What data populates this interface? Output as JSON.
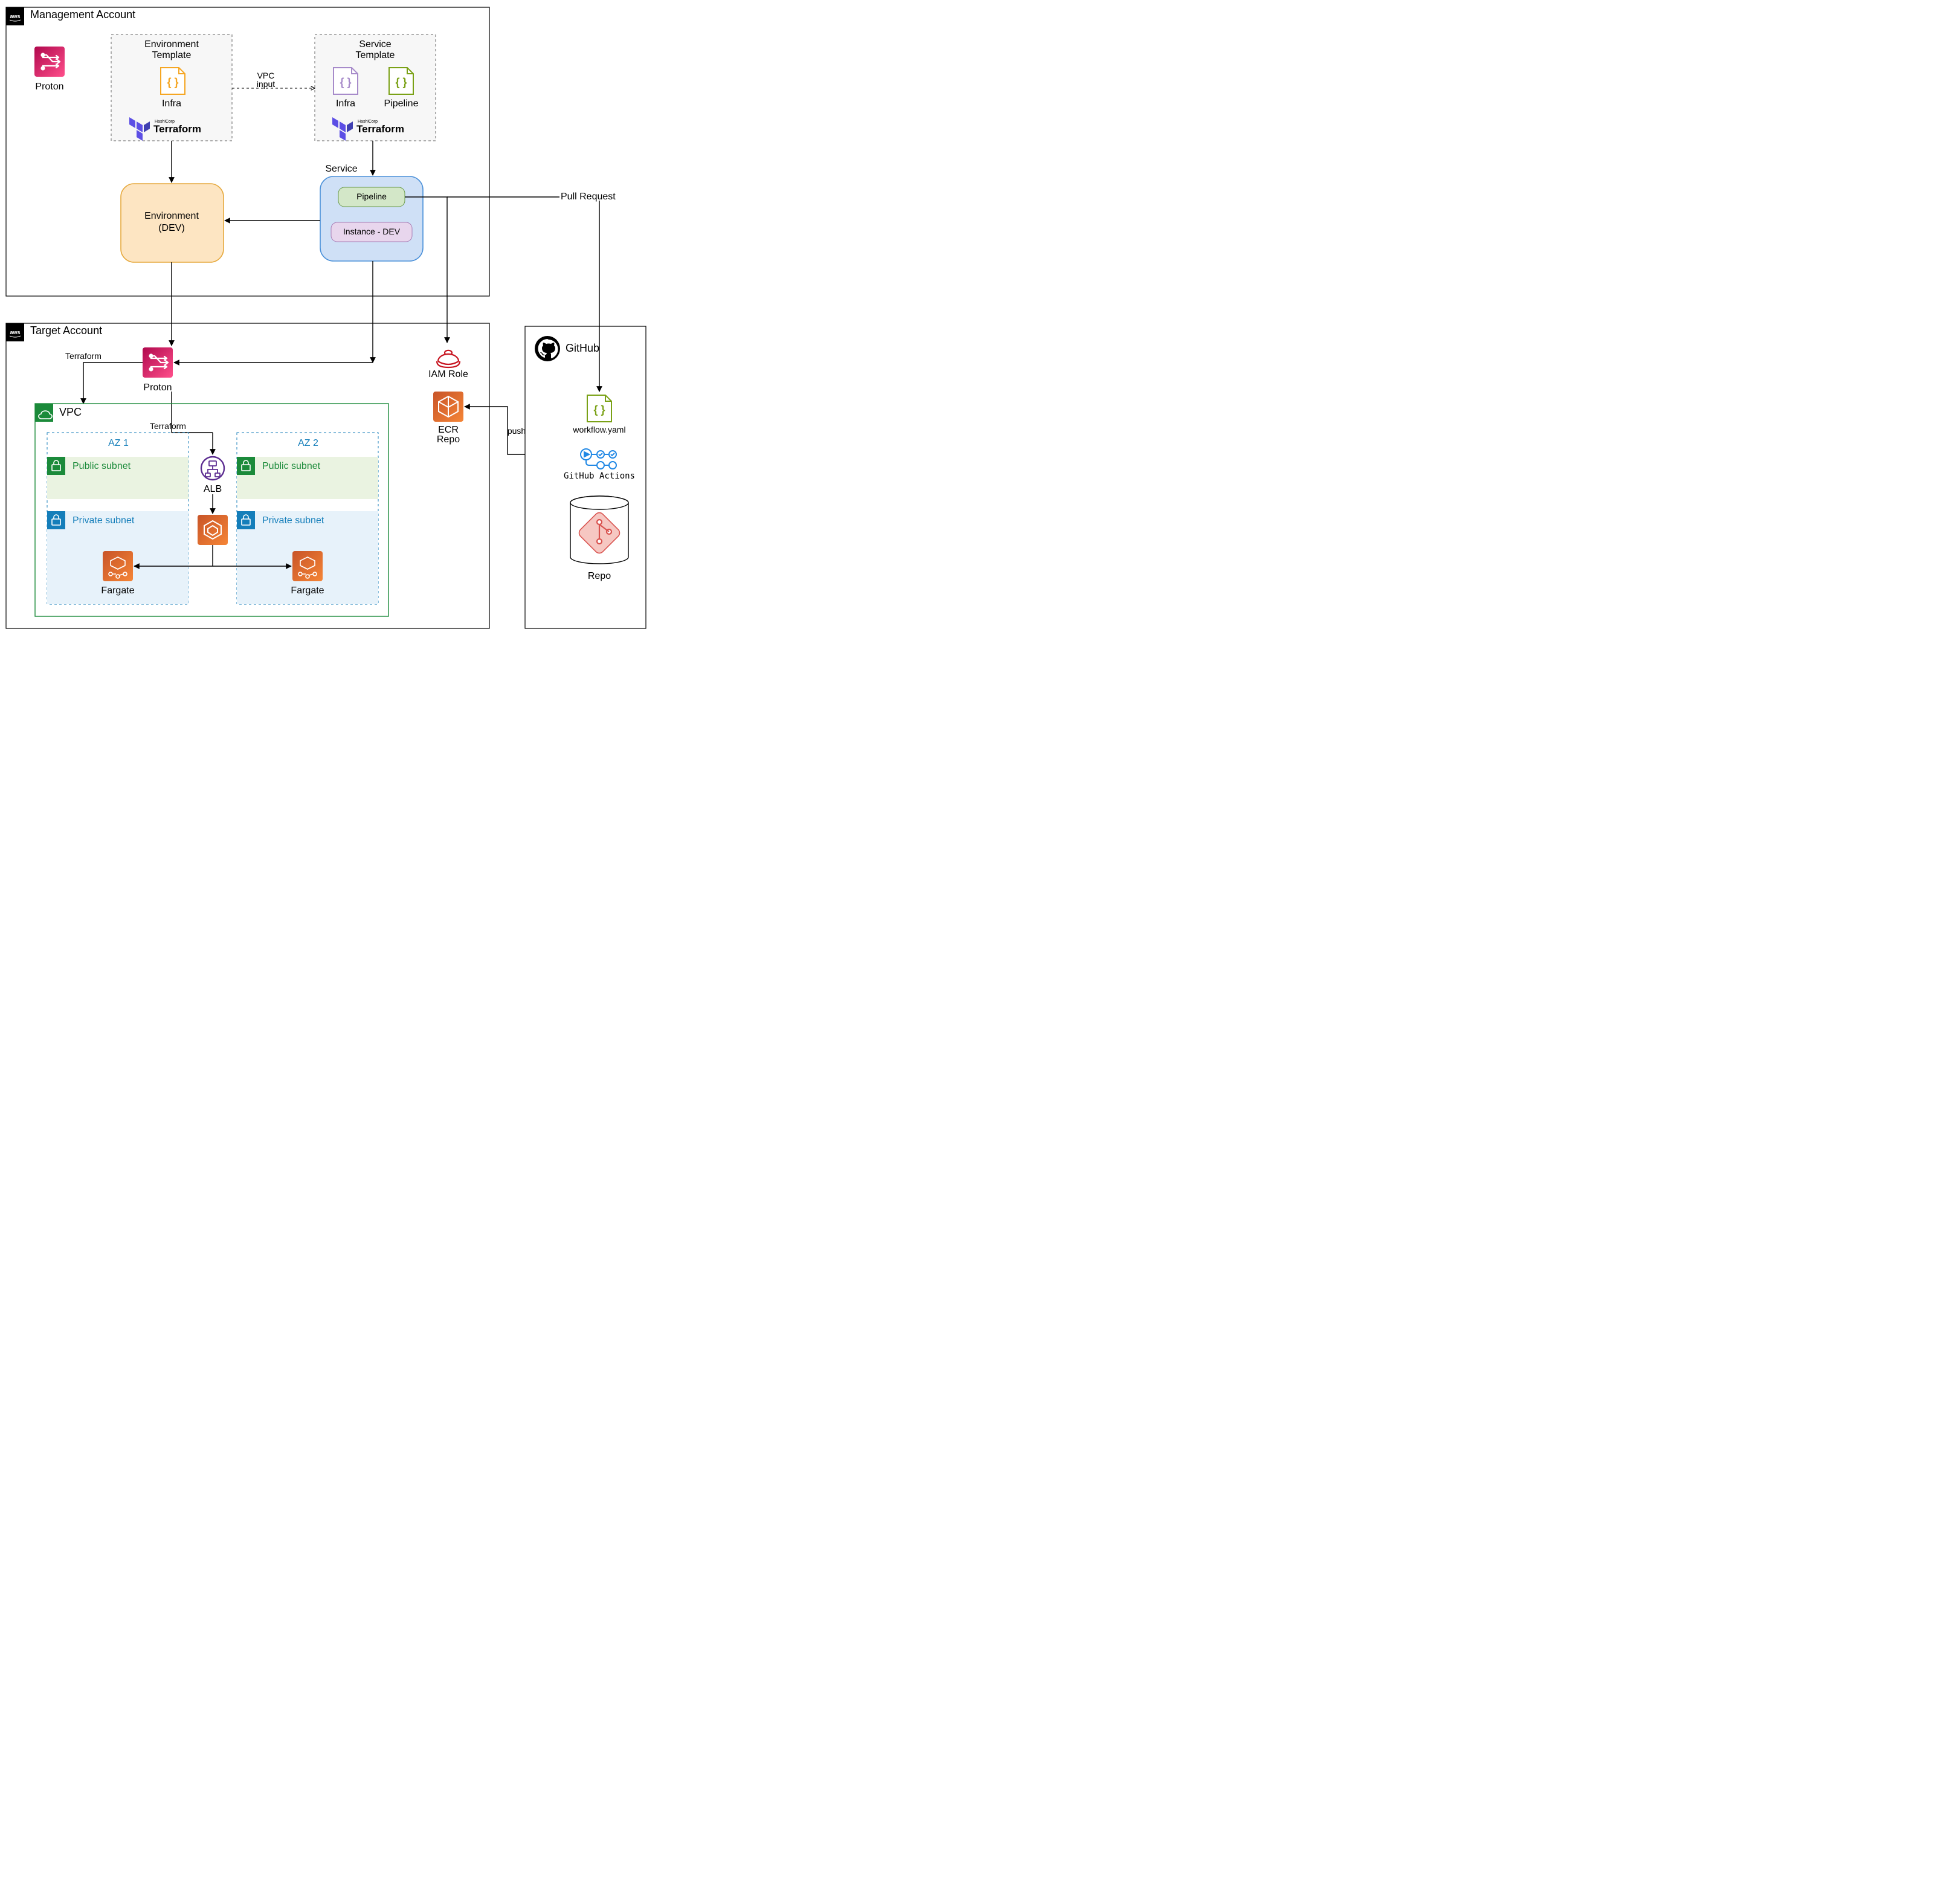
{
  "management_account": {
    "title": "Management Account"
  },
  "target_account": {
    "title": "Target Account"
  },
  "proton_mgmt_label": "Proton",
  "proton_target_label": "Proton",
  "env_template": {
    "title": "Environment\nTemplate",
    "infra_label": "Infra",
    "tool": "Terraform"
  },
  "service_template": {
    "title": "Service\nTemplate",
    "infra_label": "Infra",
    "pipeline_label": "Pipeline",
    "tool": "Terraform"
  },
  "vpc_input_label": "VPC\ninput",
  "environment_box": {
    "title": "Environment\n(DEV)"
  },
  "service_box": {
    "title": "Service",
    "pipeline_label": "Pipeline",
    "instance_label": "Instance - DEV"
  },
  "pull_request_label": "Pull Request",
  "terraform_edge_1": "Terraform",
  "terraform_edge_2": "Terraform",
  "vpc": {
    "title": "VPC",
    "az1_label": "AZ 1",
    "az2_label": "AZ 2",
    "public_subnet_label": "Public subnet",
    "private_subnet_label": "Private subnet",
    "alb_label": "ALB",
    "fargate_label": "Fargate"
  },
  "iam_role_label": "IAM Role",
  "ecr_repo_label": "ECR\nRepo",
  "push_label": "push",
  "github": {
    "title": "GitHub",
    "workflow_label": "workflow.yaml",
    "actions_label": "GitHub Actions",
    "repo_label": "Repo"
  }
}
